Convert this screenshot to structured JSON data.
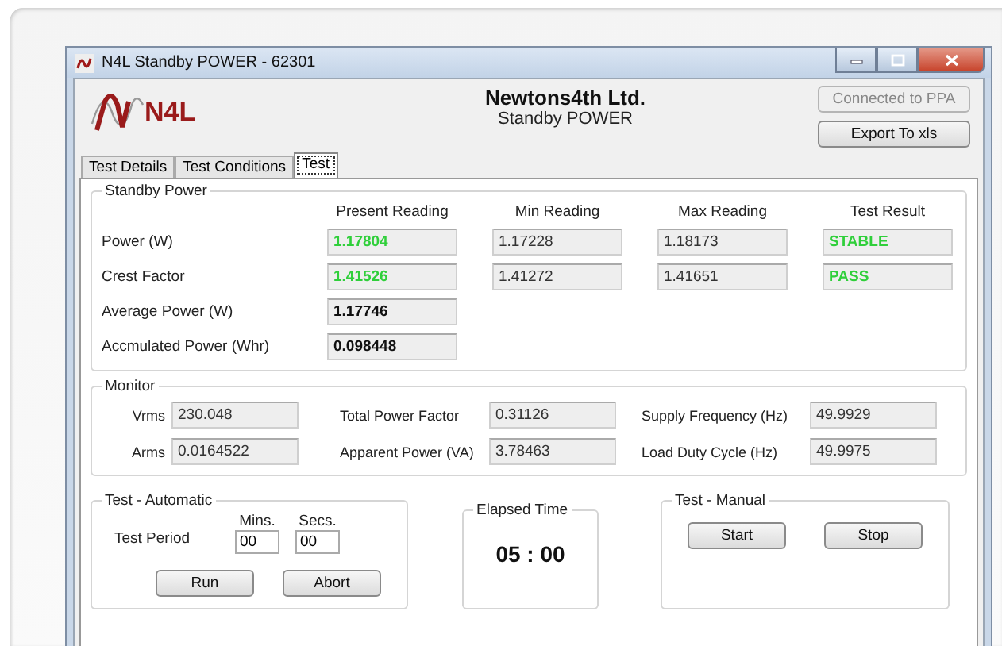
{
  "window": {
    "title": "N4L Standby POWER - 62301"
  },
  "header": {
    "logo": "N4L",
    "company": "Newtons4th Ltd.",
    "product": "Standby POWER"
  },
  "buttons": [
    {
      "label": "Connected to PPA",
      "disabled": true
    },
    {
      "label": "Export To xls",
      "disabled": false
    }
  ],
  "tabs": [
    {
      "label": "Test Details",
      "selected": false
    },
    {
      "label": "Test Conditions",
      "selected": false
    },
    {
      "label": "Test",
      "selected": true
    }
  ],
  "standby_power": {
    "title": "Standby Power",
    "columns": [
      "Present Reading",
      "Min Reading",
      "Max Reading",
      "Test Result"
    ],
    "rows": [
      {
        "label": "Power (W)",
        "present": "1.17804",
        "kind": "live",
        "min": "1.17228",
        "max": "1.18173",
        "result": "STABLE"
      },
      {
        "label": "Crest Factor",
        "present": "1.41526",
        "kind": "live",
        "min": "1.41272",
        "max": "1.41651",
        "result": "PASS"
      },
      {
        "label": "Average Power (W)",
        "present": "1.17746",
        "kind": "total"
      },
      {
        "label": "Accmulated Power (Whr)",
        "present": "0.098448",
        "kind": "total"
      }
    ]
  },
  "monitor": {
    "title": "Monitor",
    "fields": [
      {
        "label": "Vrms",
        "value": "230.048"
      },
      {
        "label": "Total Power Factor",
        "value": "0.31126"
      },
      {
        "label": "Supply Frequency (Hz)",
        "value": "49.9929"
      },
      {
        "label": "Arms",
        "value": "0.0164522"
      },
      {
        "label": "Apparent Power (VA)",
        "value": "3.78463"
      },
      {
        "label": "Load Duty Cycle (Hz)",
        "value": "49.9975"
      }
    ]
  },
  "test_automatic": {
    "title": "Test - Automatic",
    "label": "Test Period",
    "fields": [
      {
        "label": "Mins.",
        "value": "00"
      },
      {
        "label": "Secs.",
        "value": "00"
      }
    ],
    "buttons": [
      "Run",
      "Abort"
    ]
  },
  "elapsed_time": {
    "title": "Elapsed Time",
    "value": "05 : 00"
  },
  "test_manual": {
    "title": "Test - Manual",
    "buttons": [
      "Start",
      "Stop"
    ]
  }
}
